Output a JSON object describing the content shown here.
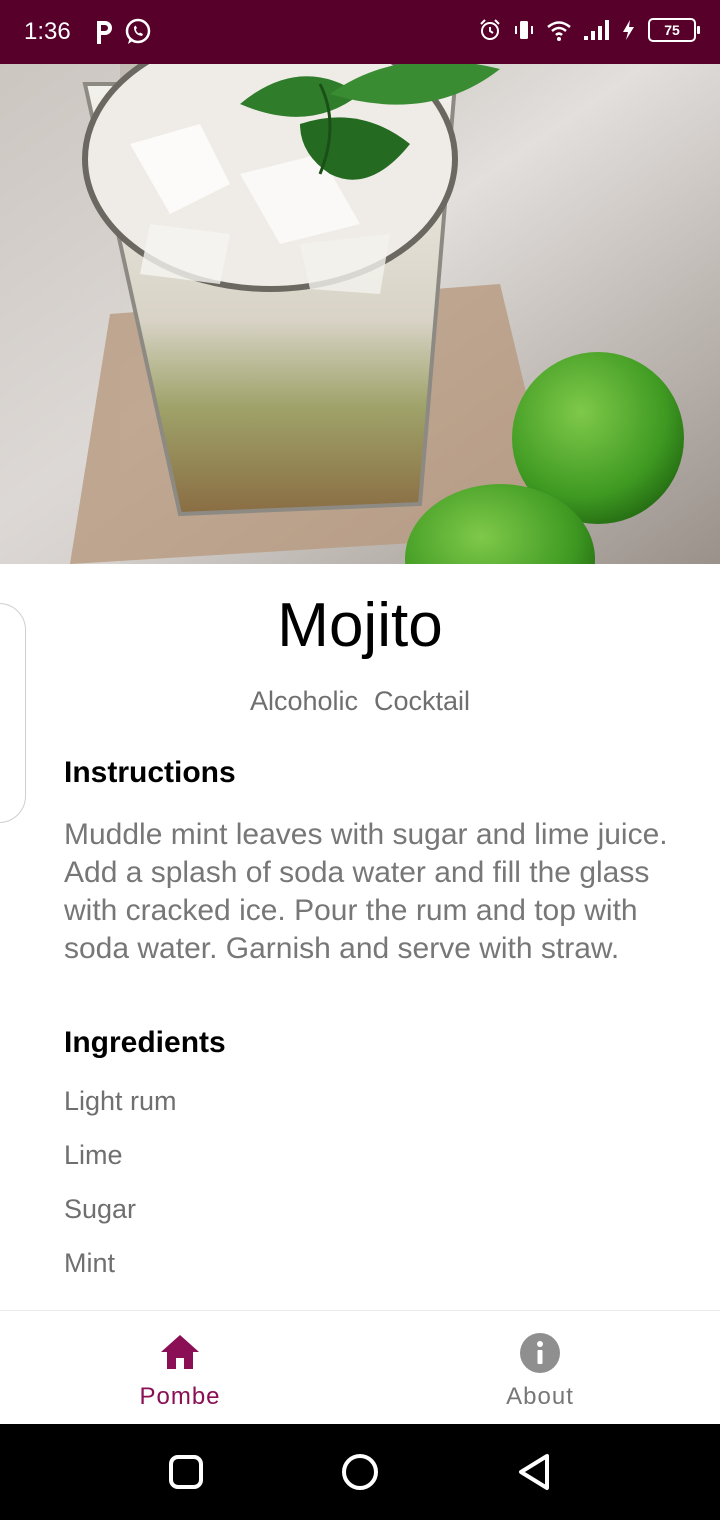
{
  "status_bar": {
    "time": "1:36",
    "battery_level": "75",
    "background_color": "#56002a"
  },
  "hero": {
    "icon": "mojito-photo"
  },
  "drink": {
    "name": "Mojito",
    "tags": [
      "Alcoholic",
      "Cocktail"
    ]
  },
  "instructions": {
    "heading": "Instructions",
    "text": "Muddle mint leaves with sugar and lime juice. Add a splash of soda water and fill the glass with cracked ice. Pour the rum and top with soda water. Garnish and serve with straw."
  },
  "ingredients": {
    "heading": "Ingredients",
    "items": [
      "Light rum",
      "Lime",
      "Sugar",
      "Mint"
    ]
  },
  "bottom_nav": {
    "items": [
      {
        "label": "Pombe",
        "icon": "home-icon",
        "active": true
      },
      {
        "label": "About",
        "icon": "info-icon",
        "active": false
      }
    ],
    "active_color": "#8b0f55",
    "inactive_color": "#777777"
  }
}
